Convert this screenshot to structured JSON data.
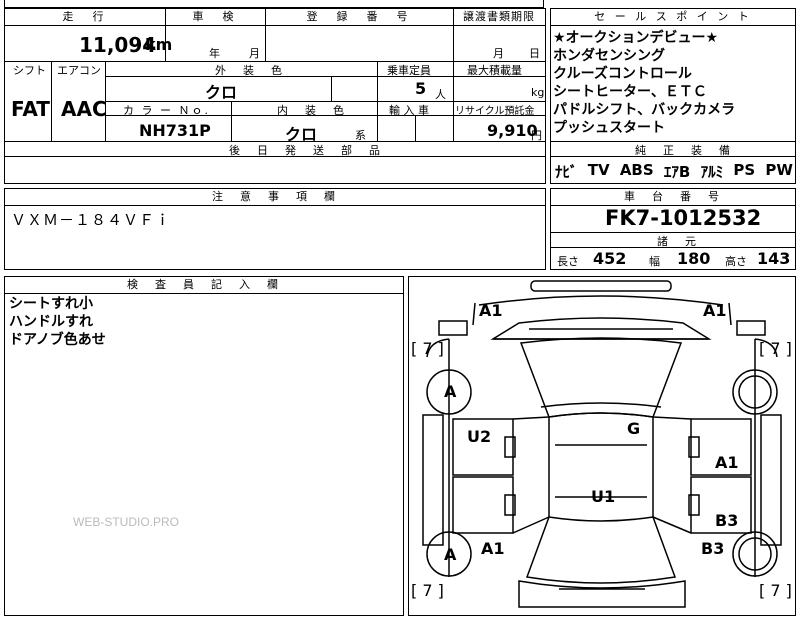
{
  "top_row": {
    "mileage_header": "走　行",
    "mileage_value": "11,094",
    "mileage_unit": "km",
    "inspection_header": "車　検",
    "inspection_year": "年",
    "inspection_month": "月",
    "registration_header": "登　録　番　号",
    "transfer_header": "譲渡書類期限",
    "transfer_month": "月",
    "transfer_day": "日"
  },
  "row2": {
    "shift_header": "シフト",
    "aircon_header": "エアコン",
    "exterior_header": "外　装　色",
    "capacity_header": "乗車定員",
    "maxload_header": "最大積載量",
    "shift_value": "FAT",
    "aircon_value": "AAC",
    "exterior_value": "クロ",
    "capacity_value": "5",
    "capacity_unit": "人",
    "maxload_unit": "kg",
    "color_no_header": "カ ラ ー Ｎｏ.",
    "interior_header": "内　装　色",
    "import_header": "輸 入 車",
    "recycle_header": "リサイクル預託金",
    "color_no_value": "NH731P",
    "interior_value": "クロ",
    "interior_suffix": "系",
    "recycle_value": "9,910",
    "recycle_unit": "円"
  },
  "later_parts_header": "後　日　発　送　部　品",
  "sales_points": {
    "header": "セ ー ル ス ポ イ ン ト",
    "lines": [
      "★オークションデビュー★",
      "ホンダセンシング",
      "クルーズコントロール",
      "シートヒーター、ＥＴＣ",
      "パドルシフト、バックカメラ",
      "プッシュスタート"
    ]
  },
  "genuine_equipment": {
    "header": "純　正　装　備",
    "items": [
      "ﾅﾋﾞ",
      "TV",
      "ABS",
      "ｴｱB",
      "ｱﾙﾐ",
      "PS",
      "PW"
    ]
  },
  "notes": {
    "header": "注　意　事　項　欄",
    "text": "ＶＸＭ－１８４ＶＦｉ"
  },
  "chassis": {
    "header": "車　台　番　号",
    "value": "FK7-1012532"
  },
  "specs": {
    "header": "諸　元",
    "length_label": "長さ",
    "length_value": "452",
    "width_label": "幅",
    "width_value": "180",
    "height_label": "高さ",
    "height_value": "143"
  },
  "inspector": {
    "header": "検　査　員　記　入　欄",
    "lines": [
      "シートすれ小",
      "ハンドルすれ",
      "ドアノブ色あせ"
    ]
  },
  "diagram": {
    "marks": {
      "a1_front_left": "A1",
      "a1_front_right": "A1",
      "tire_fl": "[ 7 ]",
      "tire_fr": "[ 7 ]",
      "wheel_fl": "A",
      "wheel_rl": "A",
      "u2": "U2",
      "g": "G",
      "a1_right_door": "A1",
      "u1": "U1",
      "b3_right_rear_door": "B3",
      "a1_left_rear": "A1",
      "b3_right_rear": "B3",
      "tire_rl": "[ 7 ]",
      "tire_rr": "[ 7 ]"
    }
  },
  "watermark": "WEB-STUDIO.PRO"
}
